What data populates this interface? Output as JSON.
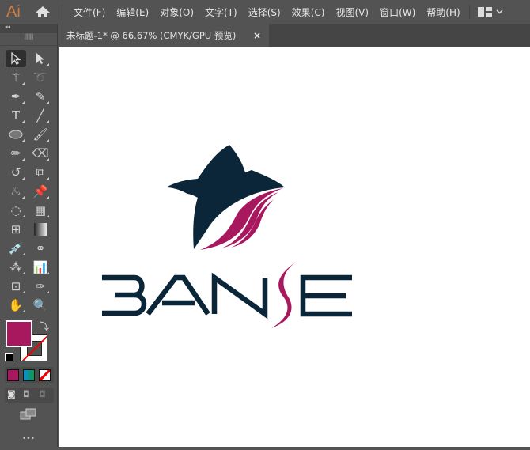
{
  "app": {
    "logo": "Ai"
  },
  "menu": [
    "文件(F)",
    "编辑(E)",
    "对象(O)",
    "文字(T)",
    "选择(S)",
    "效果(C)",
    "视图(V)",
    "窗口(W)",
    "帮助(H)"
  ],
  "document_tab": {
    "title": "未标题-1* @ 66.67% (CMYK/GPU 预览)",
    "close": "×"
  },
  "panel": {
    "collapse": "◂◂",
    "more": "•••"
  },
  "colors": {
    "fill": "#a8185f",
    "logo_dark": "#0b2638",
    "logo_accent": "#a8185f"
  },
  "artwork": {
    "wordmark": "BANSE"
  }
}
